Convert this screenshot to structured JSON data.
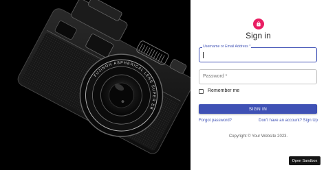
{
  "colors": {
    "primary": "#3f51b5",
    "avatar": "#e91e63",
    "hero_background": "#000000"
  },
  "hero": {
    "lens_text": "FUJINON ASPHERICAL LENS SUPER EBC f=23mm 1:2"
  },
  "login": {
    "avatar_icon": "lock-icon",
    "title": "Sign in",
    "username_label": "Username or Email Address *",
    "password_placeholder": "Password *",
    "remember_label": "Remember me",
    "submit_label": "SIGN IN",
    "forgot_link": "Forgot password?",
    "signup_link": "Don't have an account? Sign Up",
    "copyright": "Copyright © Your Website 2023."
  },
  "sandbox_button": "Open Sandbox"
}
